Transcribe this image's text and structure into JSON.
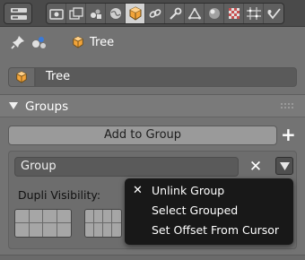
{
  "header": {
    "editor_type_icon": "properties-editor-icon",
    "context_tabs": [
      {
        "icon": "render-icon",
        "active": false
      },
      {
        "icon": "render-layers-icon",
        "active": false
      },
      {
        "icon": "scene-icon",
        "active": false
      },
      {
        "icon": "world-icon",
        "active": false
      },
      {
        "icon": "object-icon",
        "active": true
      },
      {
        "icon": "constraints-icon",
        "active": false
      },
      {
        "icon": "modifier-wrench-icon",
        "active": false
      },
      {
        "icon": "object-data-icon",
        "active": false
      },
      {
        "icon": "material-icon",
        "active": false
      },
      {
        "icon": "texture-icon",
        "active": false
      },
      {
        "icon": "particles-icon",
        "active": false
      },
      {
        "icon": "physics-icon",
        "active": false
      }
    ]
  },
  "path": {
    "label": "Tree"
  },
  "object_name": {
    "value": "Tree"
  },
  "panel": {
    "title": "Groups",
    "add_to_group_label": "Add to Group",
    "add_icon": "plus-icon",
    "group": {
      "name": "Group",
      "remove_icon": "x-icon",
      "dropdown_icon": "triangle-down-icon"
    },
    "dupli_visibility_label": "Dupli Visibility:"
  },
  "context_menu": {
    "items": [
      {
        "label": "Unlink Group",
        "icon": "x-icon"
      },
      {
        "label": "Select Grouped"
      },
      {
        "label": "Set Offset From Cursor"
      }
    ]
  },
  "colors": {
    "background": "#727272",
    "active_tab": "#d3d3d3",
    "menu_bg": "#181818",
    "object_orange": "#f2a43a"
  }
}
